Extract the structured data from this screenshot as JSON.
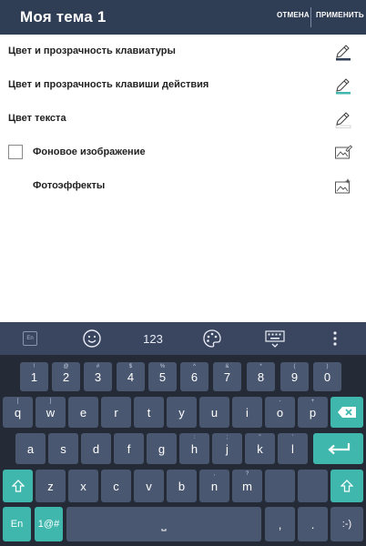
{
  "header": {
    "title": "Моя тема 1",
    "cancel_label": "ОТМЕНА",
    "apply_label": "ПРИМЕНИТЬ"
  },
  "settings": {
    "items": [
      {
        "label": "Цвет и прозрачность клавиатуры",
        "icon": "pencil-icon"
      },
      {
        "label": "Цвет и прозрачность клавиши действия",
        "icon": "pencil-teal-icon"
      },
      {
        "label": "Цвет текста",
        "icon": "pencil-icon"
      },
      {
        "label": "Фоновое изображение",
        "icon": "image-edit-icon",
        "checkbox": false
      },
      {
        "label": "Фотоэффекты",
        "icon": "photo-effects-icon"
      }
    ]
  },
  "keyboard": {
    "toolbar": {
      "language_label": "En",
      "numbers_label": "123"
    },
    "rows": [
      [
        {
          "k": "1",
          "s": "!"
        },
        {
          "k": "2",
          "s": "@"
        },
        {
          "k": "3",
          "s": "#"
        },
        {
          "k": "4",
          "s": "$"
        },
        {
          "k": "5",
          "s": "%"
        },
        {
          "k": "6",
          "s": "^"
        },
        {
          "k": "7",
          "s": "&"
        },
        {
          "k": "8",
          "s": "*"
        },
        {
          "k": "9",
          "s": "("
        },
        {
          "k": "0",
          "s": ")"
        }
      ],
      [
        {
          "k": "q",
          "s": "["
        },
        {
          "k": "w",
          "s": "]"
        },
        {
          "k": "e",
          "s": ""
        },
        {
          "k": "r",
          "s": ""
        },
        {
          "k": "t",
          "s": ""
        },
        {
          "k": "y",
          "s": ""
        },
        {
          "k": "u",
          "s": ""
        },
        {
          "k": "i",
          "s": ""
        },
        {
          "k": "o",
          "s": "-"
        },
        {
          "k": "p",
          "s": "+"
        }
      ],
      [
        {
          "k": "a",
          "s": ""
        },
        {
          "k": "s",
          "s": ""
        },
        {
          "k": "d",
          "s": ""
        },
        {
          "k": "f",
          "s": ""
        },
        {
          "k": "g",
          "s": ""
        },
        {
          "k": "h",
          "s": ":"
        },
        {
          "k": "j",
          "s": ";"
        },
        {
          "k": "k",
          "s": "\""
        },
        {
          "k": "l",
          "s": "'"
        }
      ],
      [
        {
          "k": "z",
          "s": ""
        },
        {
          "k": "x",
          "s": ""
        },
        {
          "k": "c",
          "s": ""
        },
        {
          "k": "v",
          "s": ""
        },
        {
          "k": "b",
          "s": ""
        },
        {
          "k": "n",
          "s": ","
        },
        {
          "k": "m",
          "s": "?"
        }
      ]
    ],
    "bottom": {
      "lang_key": "En",
      "symbols_key": "1@#",
      "space_key": "⎵",
      "comma_key": ",",
      "period_key": ".",
      "smiley_key": ":-)"
    },
    "colors": {
      "accent": "#3fb7ad",
      "key": "#4a5770",
      "header": "#2f3d55"
    }
  }
}
